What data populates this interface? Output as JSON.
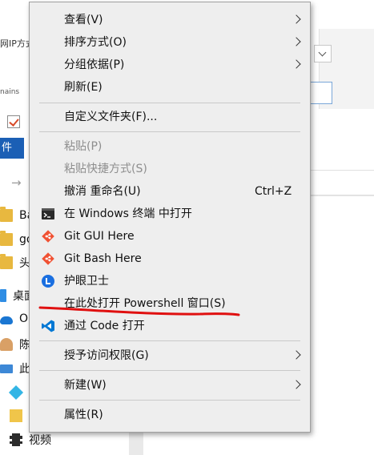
{
  "background": {
    "ip_label": "网IP方式",
    "mains_label": "nains",
    "file_tab_label": "件",
    "nav_items": [
      {
        "label": "Ba",
        "icon": "folder-icon"
      },
      {
        "label": "go",
        "icon": "folder-icon"
      },
      {
        "label": "头",
        "icon": "folder-icon"
      },
      {
        "label": "桌面",
        "icon": "desktop-icon"
      },
      {
        "label": "O",
        "icon": "onedrive-cloud-icon"
      },
      {
        "label": "陈",
        "icon": "user-icon"
      },
      {
        "label": "此",
        "icon": "this-pc-icon"
      },
      {
        "label": "",
        "icon": "3d-objects-icon"
      },
      {
        "label": "",
        "icon": "folder-icon"
      },
      {
        "label": "视频",
        "icon": "video-icon"
      }
    ]
  },
  "context_menu": {
    "items": {
      "view": "查看(V)",
      "sort_by": "排序方式(O)",
      "group_by": "分组依据(P)",
      "refresh": "刷新(E)",
      "customize_folder": "自定义文件夹(F)...",
      "paste": "粘贴(P)",
      "paste_shortcut": "粘贴快捷方式(S)",
      "undo_rename": "撤消 重命名(U)",
      "undo_shortcut": "Ctrl+Z",
      "open_in_terminal": "在 Windows 终端 中打开",
      "git_gui": "Git GUI Here",
      "git_bash": "Git Bash Here",
      "eye_guard": "护眼卫士",
      "open_powershell": "在此处打开 Powershell 窗口(S)",
      "open_with_code": "通过 Code 打开",
      "give_access": "授予访问权限(G)",
      "new": "新建(W)",
      "properties": "属性(R)"
    },
    "icons": {
      "terminal": "terminal-icon",
      "git_gui": "git-icon",
      "git_bash": "git-icon",
      "eye_guard": "eye-guard-icon",
      "vscode": "vscode-icon"
    },
    "colors": {
      "menu_bg": "#eeeeee",
      "disabled_text": "#8e8e8e",
      "annotation_red": "#e01010",
      "git_orange": "#f05133",
      "vscode_blue": "#0078d4",
      "eye_guard_blue": "#1a6fe0"
    }
  }
}
